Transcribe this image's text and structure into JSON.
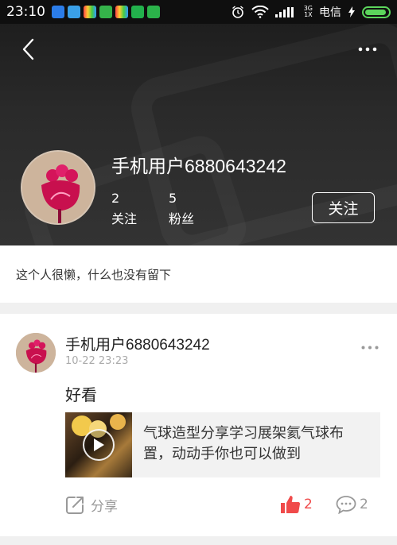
{
  "status_bar": {
    "time": "23:10",
    "network_top": "3G",
    "network_bottom": "1X",
    "carrier": "电信"
  },
  "profile": {
    "username": "手机用户6880643242",
    "following_count": "2",
    "following_label": "关注",
    "followers_count": "5",
    "followers_label": "粉丝",
    "follow_button_label": "关注",
    "bio": "这个人很懒，什么也没有留下"
  },
  "post": {
    "username": "手机用户6880643242",
    "timestamp": "10-22 23:23",
    "text": "好看",
    "shared_item": {
      "title": "气球造型分享学习展架氦气球布置，动动手你也可以做到"
    },
    "share_label": "分享",
    "like_count": "2",
    "comment_count": "2"
  },
  "colors": {
    "accent_like": "#f04a4a",
    "header_bg": "#2a2a2a",
    "battery": "#5cd65c"
  },
  "icons": [
    "back-icon",
    "more-icon",
    "alarm-icon",
    "wifi-icon",
    "signal-icon",
    "battery-icon",
    "share-icon",
    "thumbs-up-icon",
    "comment-icon",
    "play-icon"
  ]
}
